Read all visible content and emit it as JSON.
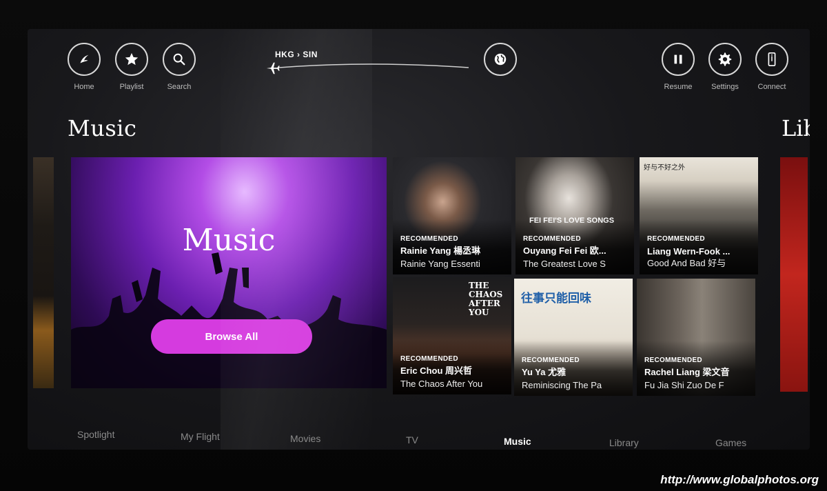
{
  "topbar": {
    "left": [
      {
        "name": "home",
        "label": "Home"
      },
      {
        "name": "playlist",
        "label": "Playlist"
      },
      {
        "name": "search",
        "label": "Search"
      }
    ],
    "right": [
      {
        "name": "resume",
        "label": "Resume"
      },
      {
        "name": "settings",
        "label": "Settings"
      },
      {
        "name": "connect",
        "label": "Connect"
      }
    ],
    "route": {
      "from": "HKG",
      "to": "SIN",
      "separator": "›"
    }
  },
  "section": {
    "title": "Music",
    "next_title": "Lib"
  },
  "hero": {
    "title": "Music",
    "button_label": "Browse All"
  },
  "tiles": [
    {
      "badge": "RECOMMENDED",
      "artist": "Rainie Yang 楊丞琳",
      "album": "Rainie Yang Essenti"
    },
    {
      "badge": "RECOMMENDED",
      "artist": "Ouyang Fei Fei 欧...",
      "album": "The Greatest Love S",
      "cover_text": "FEI FEI'S LOVE SONGS"
    },
    {
      "badge": "RECOMMENDED",
      "artist": "Liang Wern-Fook ...",
      "album": "Good And Bad 好与",
      "cover_text": "好与不好之外"
    },
    {
      "badge": "RECOMMENDED",
      "artist": "Eric Chou 周兴哲",
      "album": "The Chaos After You",
      "cover_text": "THE CHAOS AFTER YOU"
    },
    {
      "badge": "RECOMMENDED",
      "artist": "Yu Ya 尤雅",
      "album": "Reminiscing The Pa",
      "cover_text": "往事只能回味"
    },
    {
      "badge": "RECOMMENDED",
      "artist": "Rachel Liang 梁文音",
      "album": "Fu Jia Shi Zuo De F"
    }
  ],
  "nav": {
    "items": [
      "Spotlight",
      "My Flight",
      "Movies",
      "TV",
      "Music",
      "Library",
      "Games"
    ],
    "active": "Music"
  },
  "watermark": "http://www.globalphotos.org",
  "colors": {
    "accent": "#d53bdf",
    "hero_purple": "#8a2be2",
    "screen_bg": "#18181b"
  }
}
